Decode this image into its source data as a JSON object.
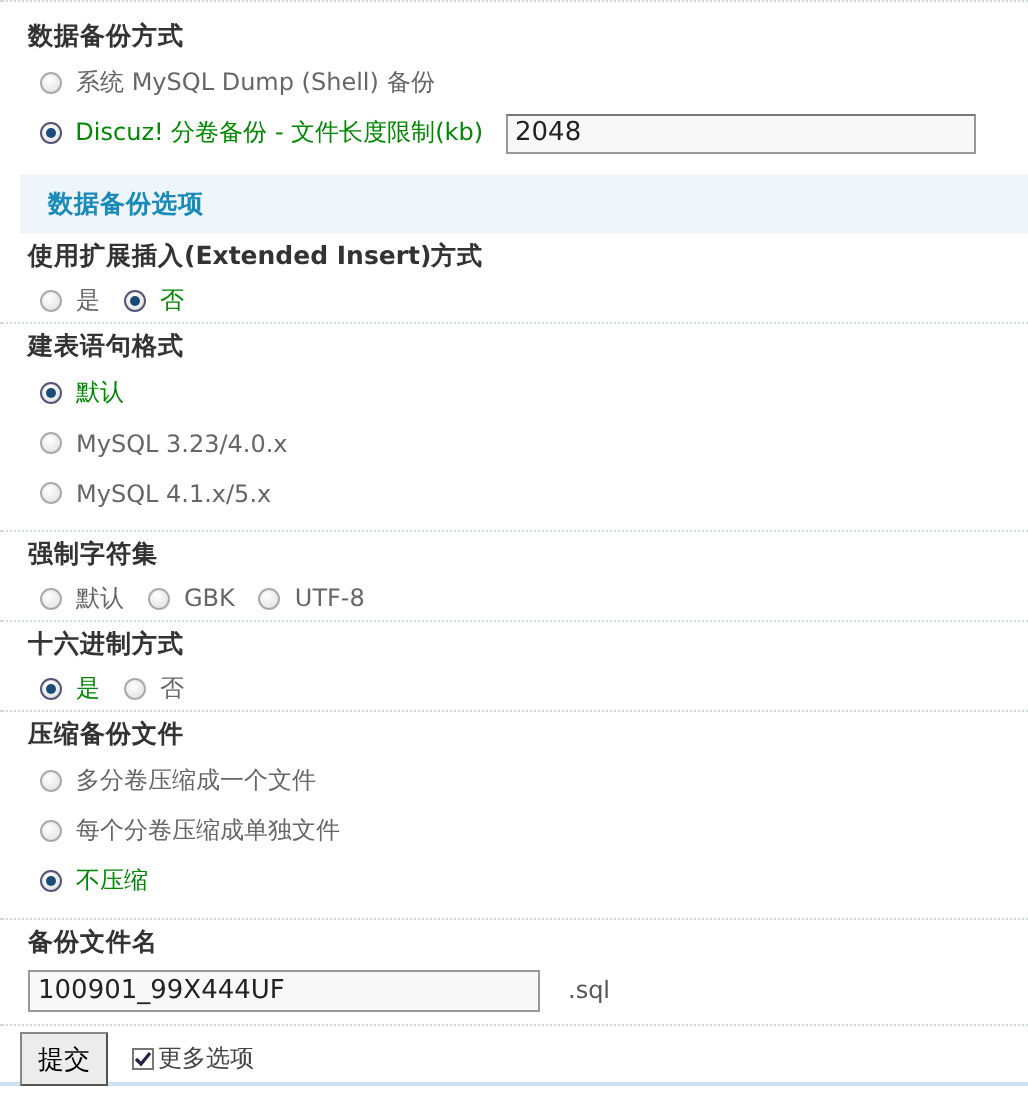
{
  "backup_method": {
    "title": "数据备份方式",
    "options": [
      {
        "label": "系统 MySQL Dump (Shell) 备份",
        "selected": false
      },
      {
        "label": "Discuz! 分卷备份 - 文件长度限制(kb)",
        "selected": true,
        "value": "2048"
      }
    ]
  },
  "options_header": "数据备份选项",
  "groups": [
    {
      "title": "使用扩展插入(Extended Insert)方式",
      "kind": "inline",
      "options": [
        {
          "label": "是",
          "selected": false
        },
        {
          "label": "否",
          "selected": true
        }
      ]
    },
    {
      "title": "建表语句格式",
      "kind": "stacked",
      "options": [
        {
          "label": "默认",
          "selected": true
        },
        {
          "label": "MySQL 3.23/4.0.x",
          "selected": false
        },
        {
          "label": "MySQL 4.1.x/5.x",
          "selected": false
        }
      ]
    },
    {
      "title": "强制字符集",
      "kind": "inline",
      "options": [
        {
          "label": "默认",
          "selected": false
        },
        {
          "label": "GBK",
          "selected": false
        },
        {
          "label": "UTF-8",
          "selected": false
        }
      ]
    },
    {
      "title": "十六进制方式",
      "kind": "inline",
      "options": [
        {
          "label": "是",
          "selected": true
        },
        {
          "label": "否",
          "selected": false
        }
      ]
    },
    {
      "title": "压缩备份文件",
      "kind": "stacked",
      "options": [
        {
          "label": "多分卷压缩成一个文件",
          "selected": false
        },
        {
          "label": "每个分卷压缩成单独文件",
          "selected": false
        },
        {
          "label": "不压缩",
          "selected": true
        }
      ]
    }
  ],
  "filename": {
    "title": "备份文件名",
    "value": "100901_99X444UF",
    "suffix": ".sql"
  },
  "submit": "提交",
  "more_options": {
    "label": "更多选项",
    "checked": true
  }
}
